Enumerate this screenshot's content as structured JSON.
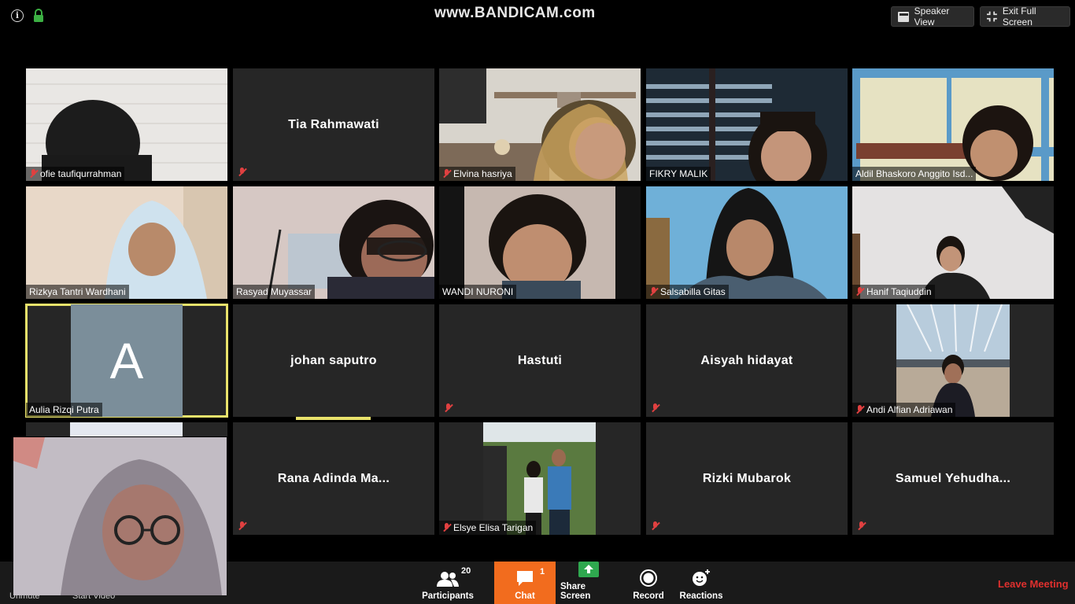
{
  "watermark": "www.BANDICAM.com",
  "top_buttons": {
    "speaker_view": "Speaker View",
    "exit_full_screen": "Exit Full Screen"
  },
  "participants": [
    {
      "name": "ofie taufiqurrahman",
      "video": true,
      "muted": true
    },
    {
      "name": "Tia Rahmawati",
      "video": false,
      "muted": true
    },
    {
      "name": "Elvina hasriya",
      "video": true,
      "muted": true
    },
    {
      "name": "FIKRY MALIK",
      "video": true,
      "muted": false
    },
    {
      "name": "Aldil Bhaskoro Anggito Isd...",
      "video": true,
      "muted": false
    },
    {
      "name": "Rizkya Tantri Wardhani",
      "video": true,
      "muted": false
    },
    {
      "name": "Rasyad Muyassar",
      "video": true,
      "muted": false
    },
    {
      "name": "WANDI NURONI",
      "video": true,
      "muted": false
    },
    {
      "name": "Salsabilla Gitas",
      "video": true,
      "muted": true
    },
    {
      "name": "Hanif Taqiuddin",
      "video": true,
      "muted": true
    },
    {
      "name": "Aulia Rizqi Putra",
      "video": false,
      "muted": false,
      "avatar_letter": "A",
      "active_speaker": true
    },
    {
      "name": "johan saputro",
      "video": false,
      "muted": false
    },
    {
      "name": "Hastuti",
      "video": false,
      "muted": true
    },
    {
      "name": "Aisyah hidayat",
      "video": false,
      "muted": true
    },
    {
      "name": "Andi Alfian Adriawan",
      "video": true,
      "muted": true
    },
    {
      "name": "Rana  Adinda  Ma...",
      "video": false,
      "muted": true
    },
    {
      "name": "Elsye Elisa Tarigan",
      "video": true,
      "muted": true
    },
    {
      "name": "Rizki Mubarok",
      "video": false,
      "muted": true
    },
    {
      "name": "Samuel  Yehudha...",
      "video": false,
      "muted": true
    }
  ],
  "toolbar": {
    "unmute": "Unmute",
    "start_video": "Start Video",
    "participants_label": "Participants",
    "participants_count": "20",
    "chat_label": "Chat",
    "chat_badge": "1",
    "share_label": "Share Screen",
    "record_label": "Record",
    "reactions_label": "Reactions",
    "leave_label": "Leave Meeting"
  },
  "colors": {
    "active_speaker": "#e9e26b",
    "chat_bg": "#f26c1e",
    "leave": "#e0302e",
    "share_green": "#2fa84f",
    "mute_red": "#e04040"
  }
}
